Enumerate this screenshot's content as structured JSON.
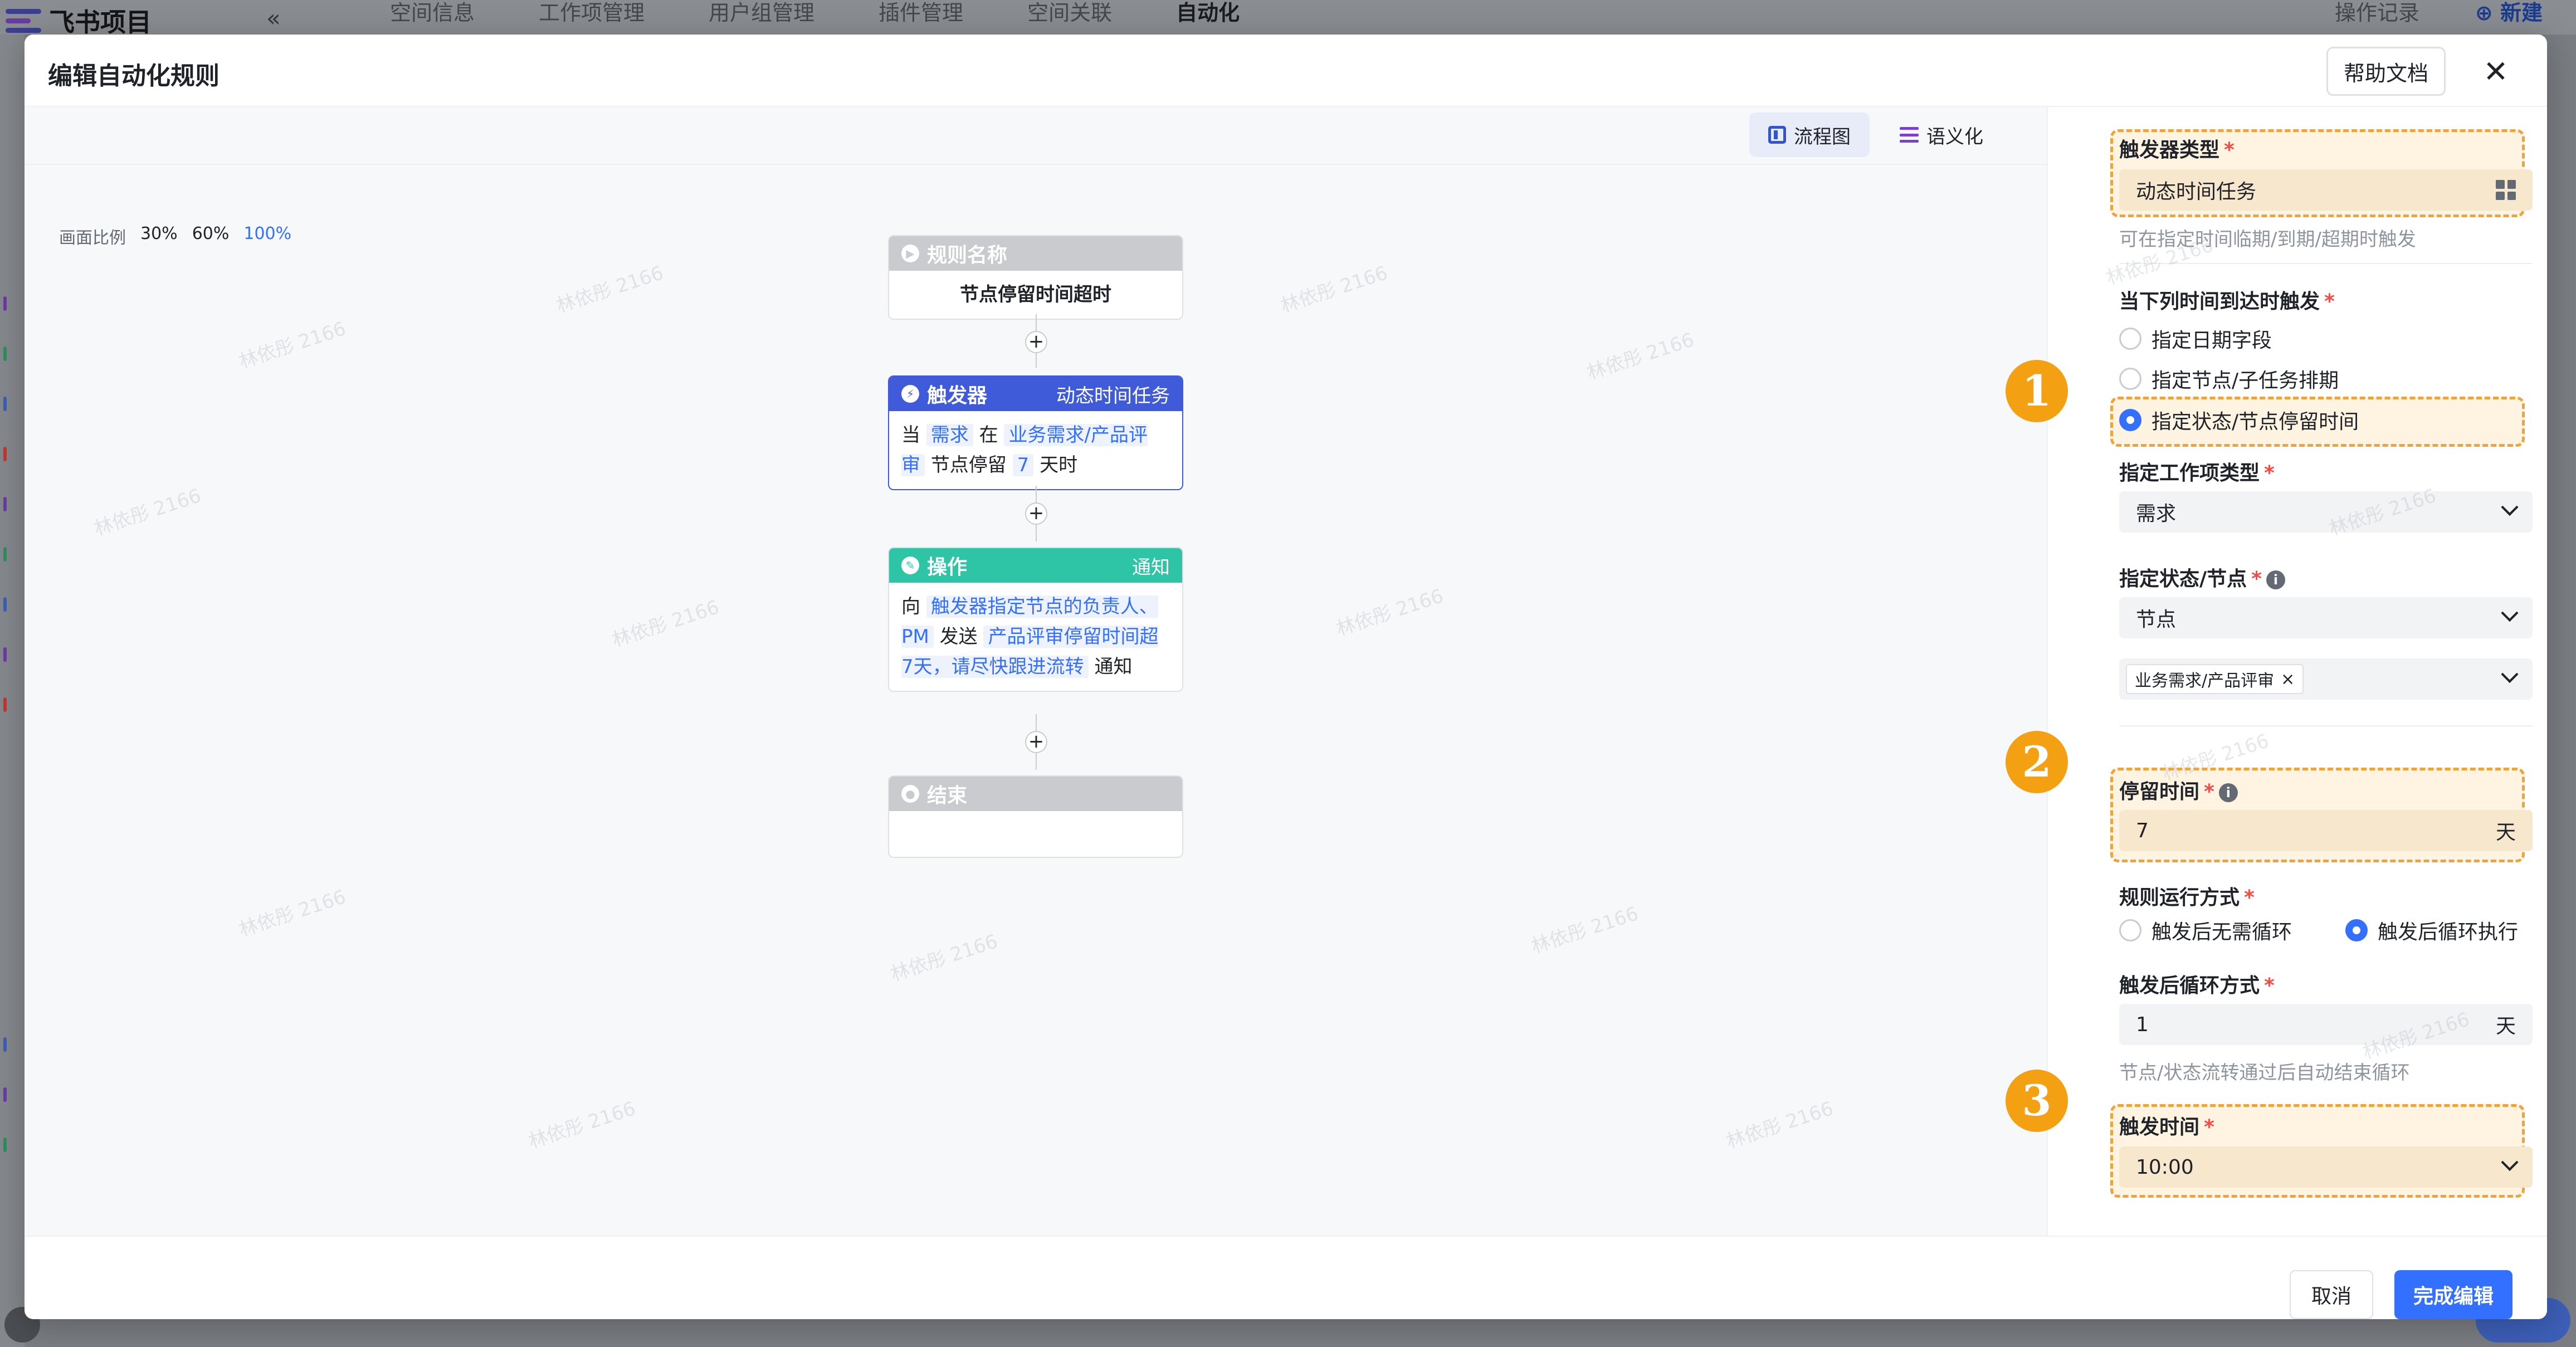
{
  "app": {
    "name": "飞书项目",
    "tabs": [
      "空间信息",
      "工作项管理",
      "用户组管理",
      "插件管理",
      "空间关联",
      "自动化"
    ],
    "active_tab": "自动化",
    "right_links": {
      "log": "操作记录",
      "new": "新建"
    }
  },
  "modal": {
    "title": "编辑自动化规则",
    "help_label": "帮助文档",
    "close_icon": "close-icon"
  },
  "toolbar": {
    "flow_view": "流程图",
    "semantic_view": "语义化"
  },
  "scale": {
    "label": "画面比例",
    "options": [
      "30%",
      "60%",
      "100%"
    ],
    "current": "100%"
  },
  "flow": {
    "rule": {
      "header": "规则名称",
      "name": "节点停留时间超时"
    },
    "trigger": {
      "header": "触发器",
      "type": "动态时间任务",
      "text_when": "当",
      "item": "需求",
      "text_at": "在",
      "node": "业务需求/产品评审",
      "text_stay": "节点停留",
      "days": "7",
      "text_unit": "天时"
    },
    "action": {
      "header": "操作",
      "type": "通知",
      "text_to": "向",
      "recipients": "触发器指定节点的负责人、PM",
      "text_send": "发送",
      "message": "产品评审停留时间超7天，请尽快跟进流转",
      "text_notify": "通知"
    },
    "end": {
      "header": "结束"
    },
    "plus": "+"
  },
  "panel": {
    "trigger_type": {
      "label": "触发器类型",
      "required": "*",
      "value": "动态时间任务",
      "helper": "可在指定时间临期/到期/超期时触发"
    },
    "when": {
      "label": "当下列时间到达时触发",
      "required": "*",
      "options": [
        "指定日期字段",
        "指定节点/子任务排期",
        "指定状态/节点停留时间"
      ],
      "selected": 2
    },
    "work_item_type": {
      "label": "指定工作项类型",
      "required": "*",
      "value": "需求"
    },
    "state_node": {
      "label": "指定状态/节点",
      "required": "*",
      "info": "i",
      "value": "节点",
      "tag": "业务需求/产品评审",
      "tag_close": "×"
    },
    "stay_time": {
      "label": "停留时间",
      "required": "*",
      "info": "i",
      "value": "7",
      "unit": "天"
    },
    "run_mode": {
      "label": "规则运行方式",
      "required": "*",
      "options": [
        "触发后无需循环",
        "触发后循环执行"
      ],
      "selected": 1
    },
    "loop": {
      "label": "触发后循环方式",
      "required": "*",
      "value": "1",
      "unit": "天",
      "helper": "节点/状态流转通过后自动结束循环"
    },
    "trigger_time": {
      "label": "触发时间",
      "required": "*",
      "value": "10:00"
    }
  },
  "badges": [
    "1",
    "2",
    "3"
  ],
  "footer": {
    "cancel": "取消",
    "done": "完成编辑"
  },
  "colors": {
    "accent": "#3370ff",
    "highlight": "#f0a33a",
    "trigger_head": "#3f5bd9",
    "action_head": "#2ec4a6",
    "neutral_head": "#c9cbcf"
  }
}
